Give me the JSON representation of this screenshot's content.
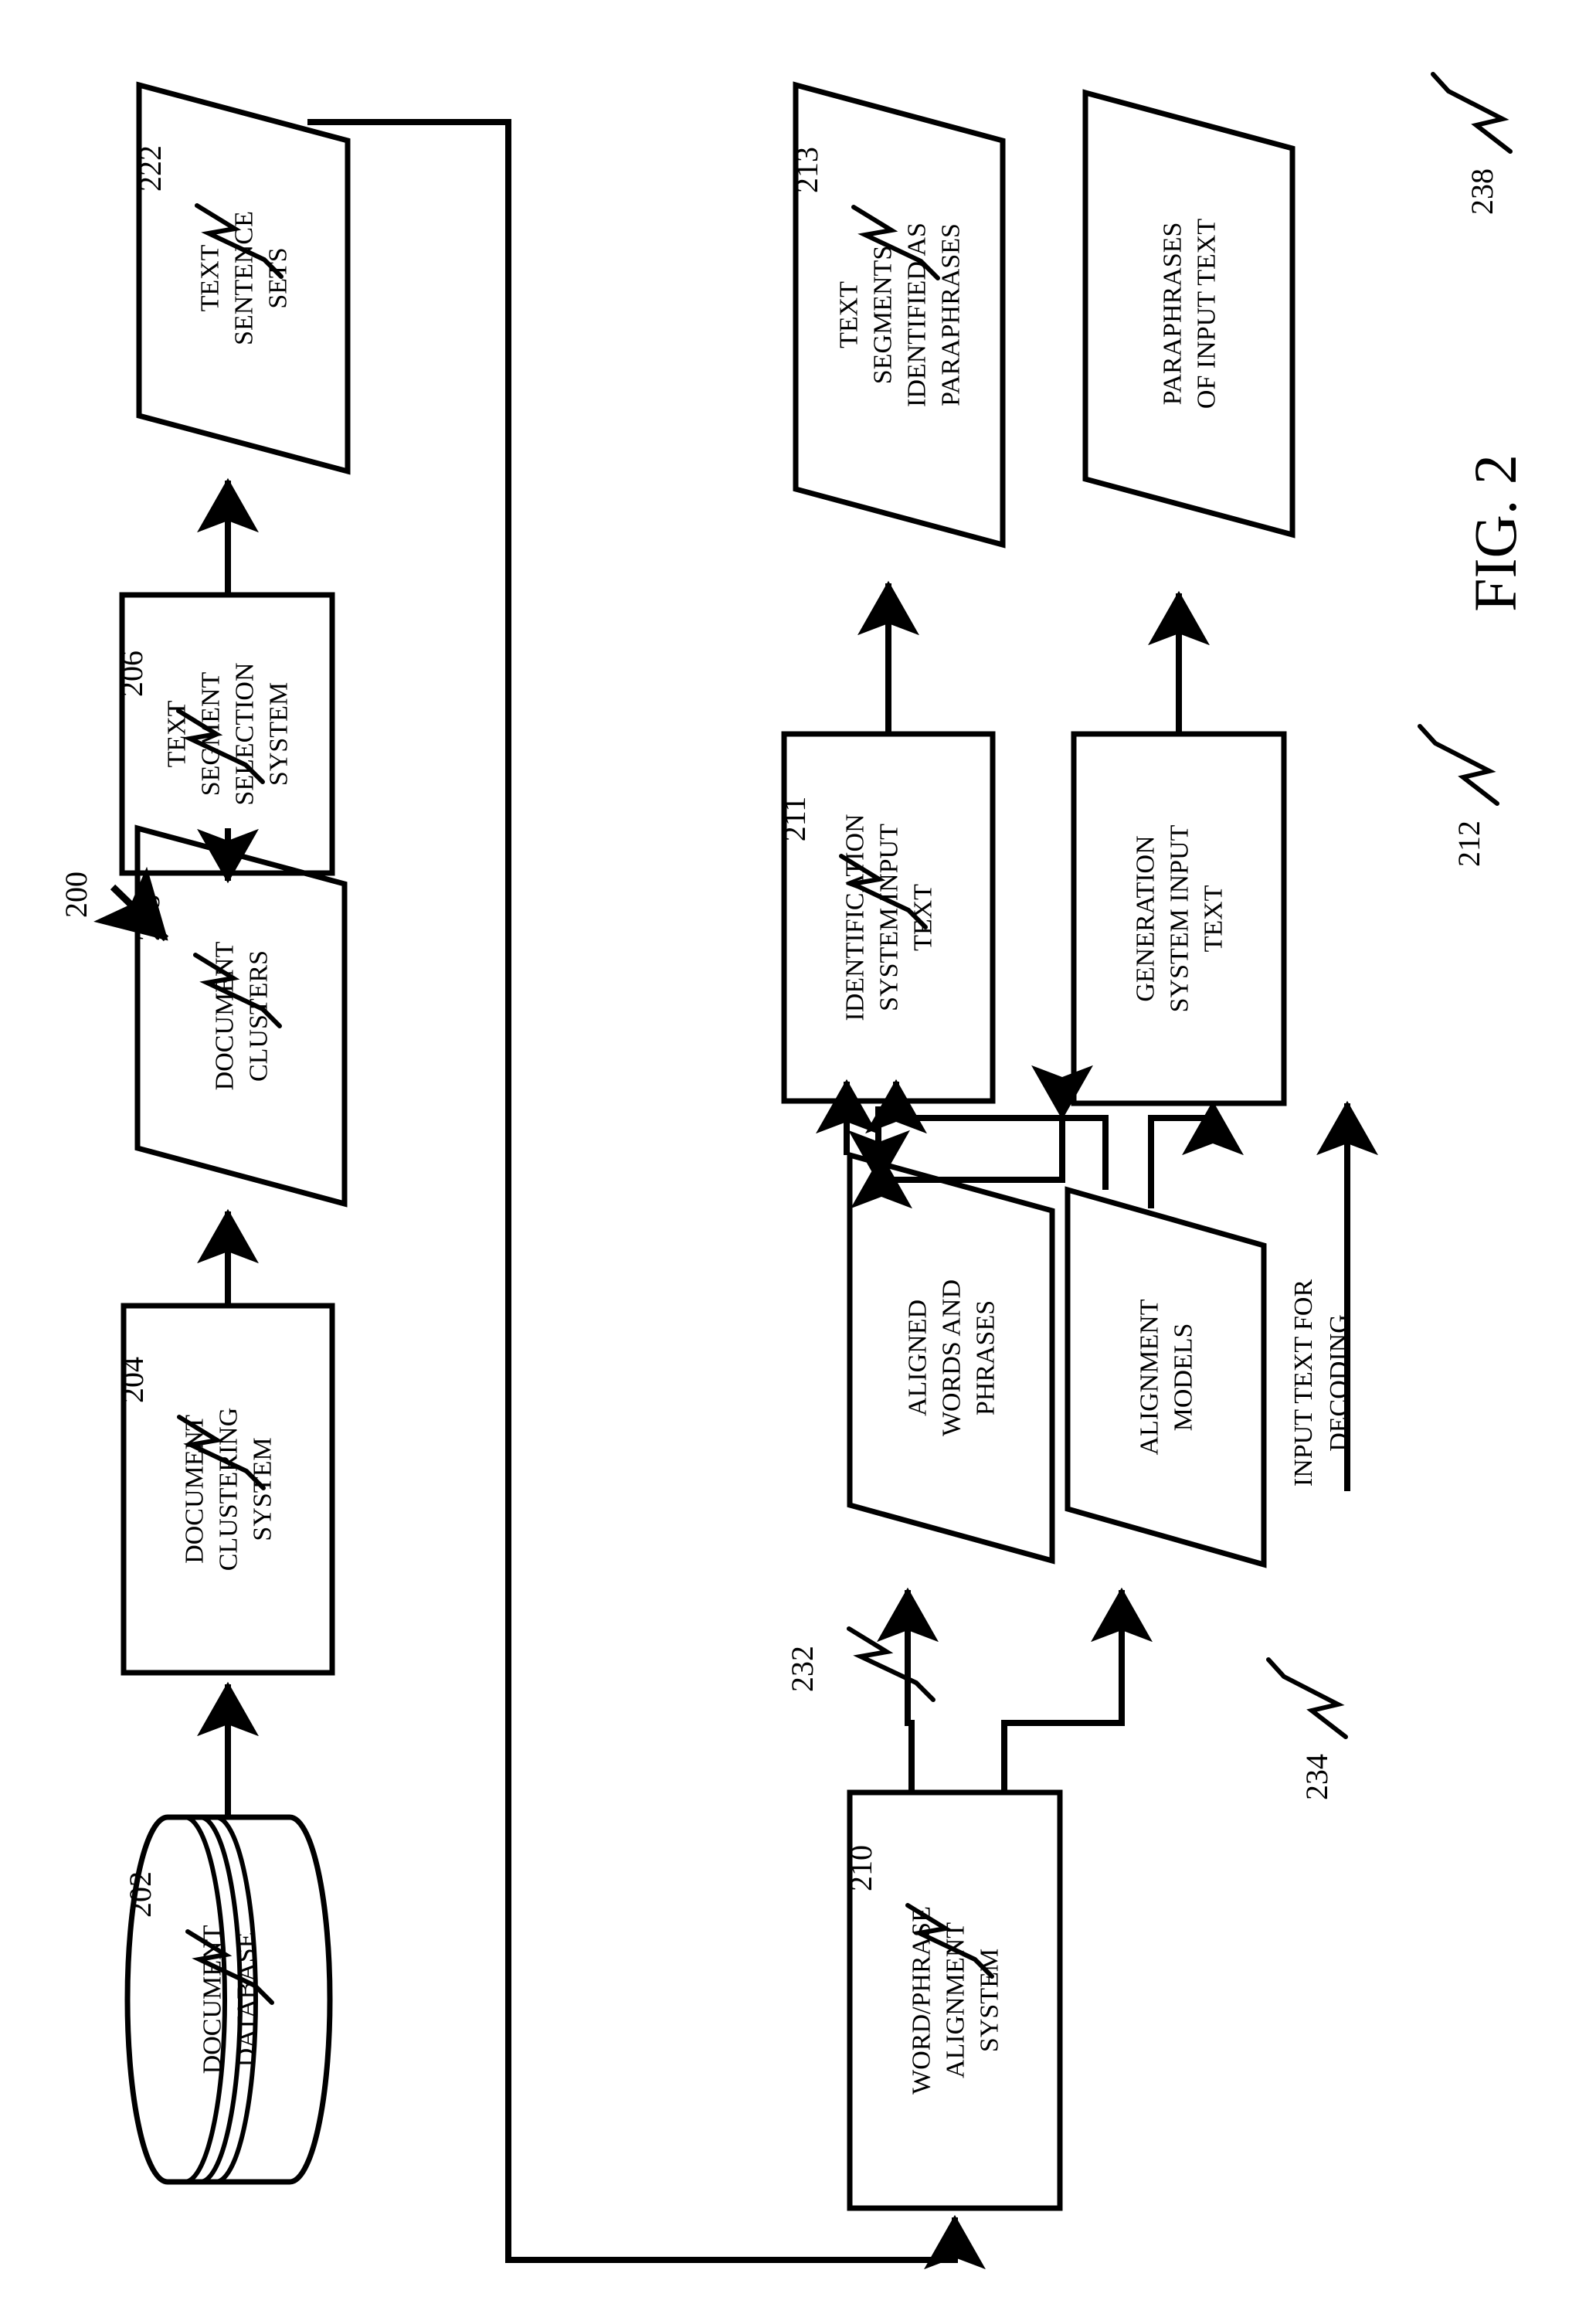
{
  "figure": {
    "label": "FIG. 2",
    "diagram_number": "200",
    "orientation": "rotated-90-ccw",
    "type": "patent-block-flow-diagram"
  },
  "nodes": [
    {
      "id": "n202",
      "ref": "202",
      "shape": "cylinder",
      "lines": [
        "DOCUMENT",
        "DATABASE"
      ]
    },
    {
      "id": "n204",
      "ref": "204",
      "shape": "rectangle",
      "lines": [
        "DOCUMENT",
        "CLUSTERING",
        "SYSTEM"
      ]
    },
    {
      "id": "n218",
      "ref": "218",
      "shape": "parallelogram",
      "lines": [
        "DOCUMENT",
        "CLUSTERS"
      ]
    },
    {
      "id": "n206",
      "ref": "206",
      "shape": "rectangle",
      "lines": [
        "TEXT",
        "SEGMENT",
        "SELECTION",
        "SYSTEM"
      ]
    },
    {
      "id": "n222",
      "ref": "222",
      "shape": "parallelogram",
      "lines": [
        "TEXT",
        "SENTENCE",
        "SETS"
      ]
    },
    {
      "id": "n210",
      "ref": "210",
      "shape": "rectangle",
      "lines": [
        "WORD/PHRASE",
        "ALIGNMENT",
        "SYSTEM"
      ]
    },
    {
      "id": "n232",
      "ref": "232",
      "shape": "parallelogram",
      "lines": [
        "ALIGNED",
        "WORDS AND",
        "PHRASES"
      ]
    },
    {
      "id": "n234",
      "ref": "234",
      "shape": "parallelogram",
      "lines": [
        "ALIGNMENT",
        "MODELS"
      ]
    },
    {
      "id": "n211",
      "ref": "211",
      "shape": "rectangle",
      "lines": [
        "IDENTIFICATION",
        "SYSTEM INPUT",
        "TEXT"
      ]
    },
    {
      "id": "n213",
      "ref": "213",
      "shape": "parallelogram",
      "lines": [
        "TEXT",
        "SEGMENTS",
        "IDENTIFIED AS",
        "PARAPHRASES"
      ]
    },
    {
      "id": "n212",
      "ref": "212",
      "shape": "rectangle",
      "lines": [
        "GENERATION",
        "SYSTEM INPUT",
        "TEXT"
      ]
    },
    {
      "id": "n238",
      "ref": "238",
      "shape": "parallelogram",
      "lines": [
        "PARAPHRASES",
        "OF INPUT TEXT"
      ]
    }
  ],
  "free_labels": [
    {
      "id": "l_input_decode",
      "lines": [
        "INPUT TEXT FOR",
        "DECODING"
      ]
    }
  ],
  "ref_numerals": [
    "202",
    "204",
    "218",
    "206",
    "222",
    "210",
    "232",
    "234",
    "211",
    "213",
    "212",
    "238",
    "200"
  ],
  "edges": [
    {
      "from": "n202",
      "to": "n204",
      "style": "solid-arrow"
    },
    {
      "from": "n204",
      "to": "n218",
      "style": "solid-arrow"
    },
    {
      "from": "n218",
      "to": "n206",
      "style": "solid-arrow"
    },
    {
      "from": "n206",
      "to": "n222",
      "style": "solid-arrow"
    },
    {
      "from": "n222",
      "to": "n210",
      "style": "feedback-loop"
    },
    {
      "from": "n210",
      "to": "n232",
      "style": "solid-arrow"
    },
    {
      "from": "n210",
      "to": "n234",
      "style": "solid-arrow"
    },
    {
      "from": "n232",
      "to": "n211",
      "style": "solid-arrow"
    },
    {
      "from": "n232",
      "to": "n212",
      "style": "routed-arrow"
    },
    {
      "from": "n234",
      "to": "n211",
      "style": "routed-arrow"
    },
    {
      "from": "n234",
      "to": "n212",
      "style": "routed-arrow"
    },
    {
      "from": "l_input_decode",
      "to": "n212",
      "style": "solid-arrow"
    },
    {
      "from": "n211",
      "to": "n213",
      "style": "solid-arrow"
    },
    {
      "from": "n212",
      "to": "n238",
      "style": "solid-arrow"
    }
  ],
  "colors": {
    "ink": "#000000",
    "paper": "#ffffff"
  }
}
